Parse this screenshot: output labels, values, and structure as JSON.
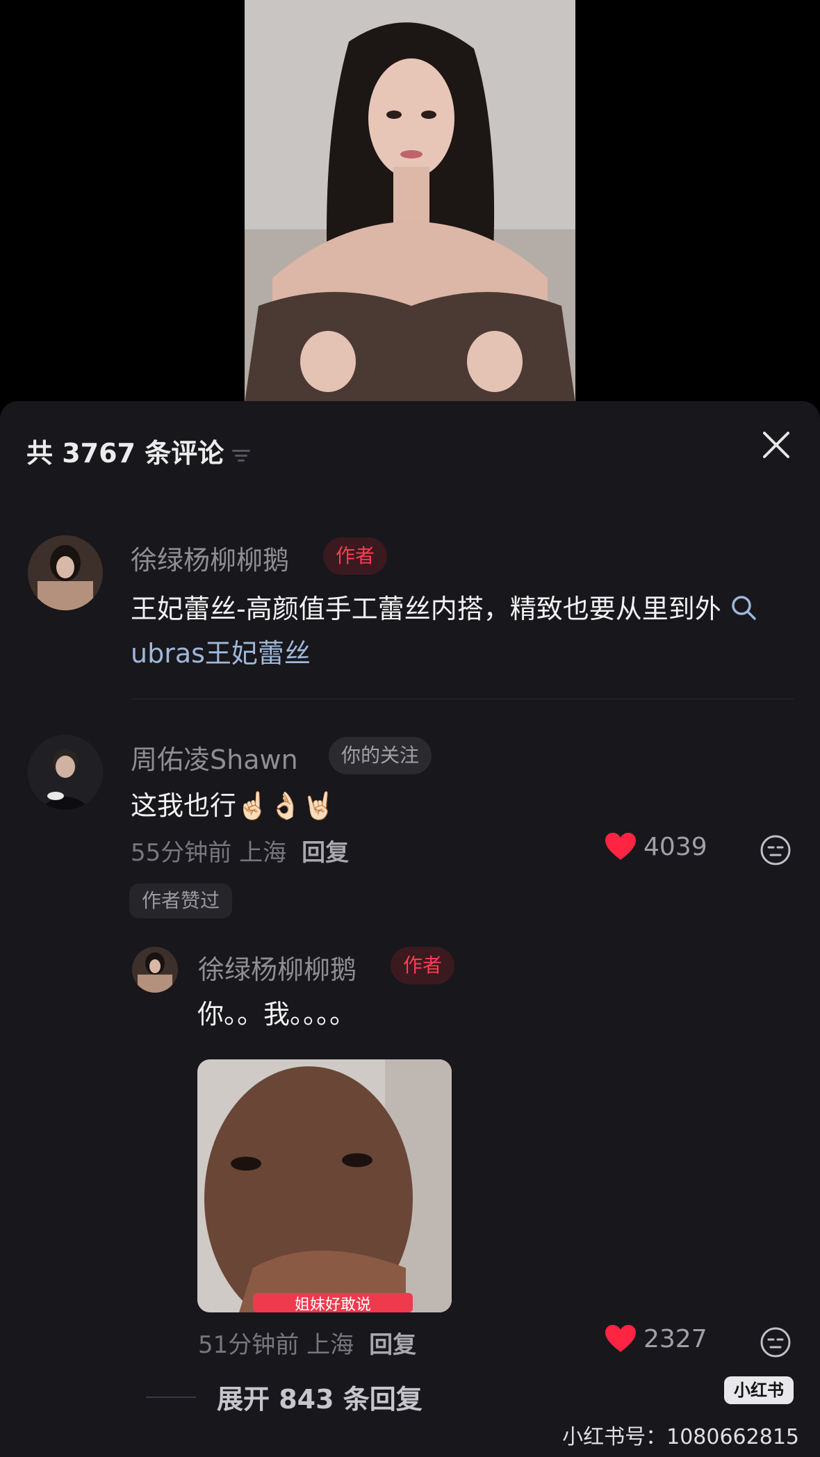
{
  "header": {
    "title": "共 3767 条评论"
  },
  "comments": [
    {
      "username": "徐绿杨柳柳鹅",
      "badge": "作者",
      "text": "王妃蕾丝-高颜值手工蕾丝内搭，精致也要从里到外",
      "search_text": "ubras王妃蕾丝"
    },
    {
      "username": "周佑凌Shawn",
      "badge": "你的关注",
      "text": "这我也行☝🏻👌🏻🤘🏻",
      "time": "55分钟前 上海",
      "reply_label": "回复",
      "likes": "4039",
      "liked_badge": "作者赞过",
      "replies": [
        {
          "username": "徐绿杨柳柳鹅",
          "badge": "作者",
          "text": "你。。我。。。。",
          "image_caption": "姐妹好敢说",
          "time": "51分钟前 上海",
          "reply_label": "回复",
          "likes": "2327"
        }
      ],
      "expand_label": "展开 843 条回复"
    }
  ],
  "watermark": {
    "logo": "小红书",
    "id": "小红书号：1080662815"
  },
  "colors": {
    "sheet_bg": "#17171c",
    "heart": "#ff2442",
    "author_badge": "#ff3b54"
  }
}
